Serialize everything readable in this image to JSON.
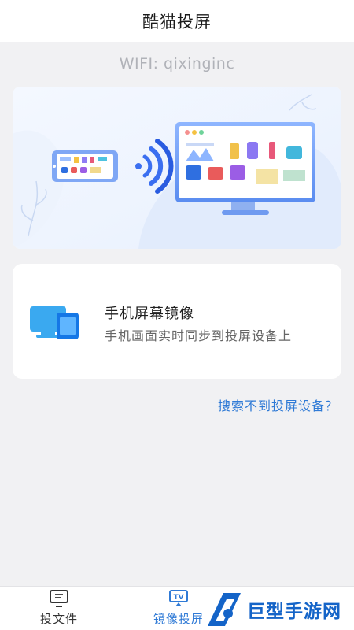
{
  "header": {
    "title": "酷猫投屏"
  },
  "wifi": {
    "label": "WIFI: qixinginc"
  },
  "feature": {
    "title": "手机屏幕镜像",
    "description": "手机画面实时同步到投屏设备上"
  },
  "help": {
    "link_text": "搜索不到投屏设备？"
  },
  "nav": {
    "items": [
      {
        "label": "投文件",
        "icon": "cast-file-icon",
        "active": false
      },
      {
        "label": "镜像投屏",
        "icon": "tv-mirror-icon",
        "active": true
      }
    ]
  },
  "watermark": {
    "text": "巨型手游网"
  },
  "colors": {
    "accent": "#2f7ad6",
    "background": "#f1f1f3",
    "card": "#ffffff",
    "muted_text": "#b0b2b8"
  }
}
